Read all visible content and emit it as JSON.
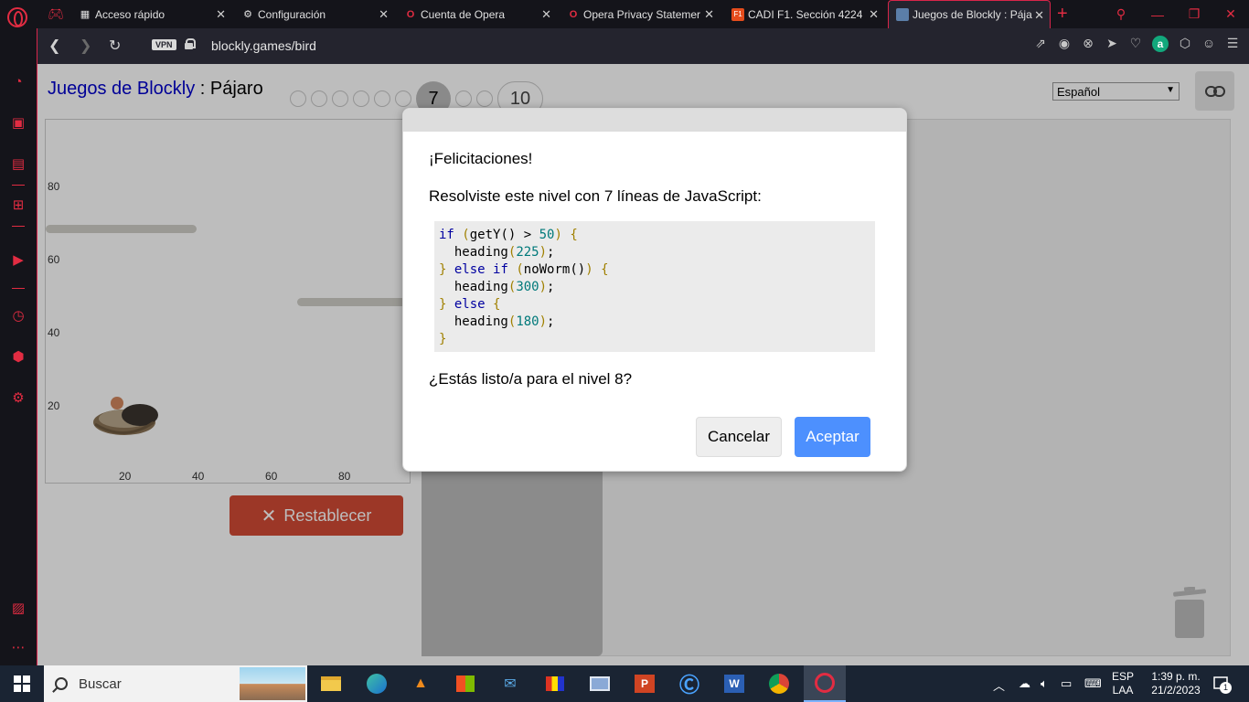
{
  "tabs": [
    {
      "title": "Acceso rápido",
      "icon": "grid-icon"
    },
    {
      "title": "Configuración",
      "icon": "gear-icon"
    },
    {
      "title": "Cuenta de Opera",
      "icon": "opera-icon"
    },
    {
      "title": "Opera Privacy Statemer",
      "icon": "opera-icon"
    },
    {
      "title": "CADI F1. Sección 4224",
      "icon": "f1-icon"
    },
    {
      "title": "Juegos de Blockly : Pája",
      "icon": "puzzle-icon"
    }
  ],
  "address_bar": {
    "vpn_label": "VPN",
    "url": "blockly.games/bird"
  },
  "page": {
    "brand": "Juegos de Blockly",
    "separator": " : ",
    "game": "Pájaro",
    "current_level": "7",
    "last_level": "10",
    "levels_before_current": 6,
    "levels_between": 2,
    "language": "Español",
    "canvas": {
      "y_ticks": [
        "80",
        "60",
        "40",
        "20"
      ],
      "x_ticks": [
        "20",
        "40",
        "60",
        "80"
      ]
    },
    "reset_label": "Restablecer"
  },
  "dialog": {
    "title": "¡Felicitaciones!",
    "message": "Resolviste este nivel con 7 líneas de JavaScript:",
    "next_prompt": "¿Estás listo/a para el nivel 8?",
    "cancel_label": "Cancelar",
    "accept_label": "Aceptar",
    "code": {
      "if_kw": "if",
      "getY": "getY()",
      "gt": ">",
      "fifty": "50",
      "heading": "heading",
      "v225": "225",
      "else_kw": "else",
      "noWorm": "noWorm()",
      "v300": "300",
      "v180": "180"
    }
  },
  "taskbar": {
    "search_placeholder": "Buscar",
    "lang_top": "ESP",
    "lang_bottom": "LAA",
    "time": "1:39 p. m.",
    "date": "21/2/2023",
    "notification_count": "1"
  },
  "colors": {
    "opera_red": "#e22c42",
    "accept_blue": "#4d90fe",
    "reset_red": "#d34b35",
    "brand_blue": "#0000cc"
  }
}
